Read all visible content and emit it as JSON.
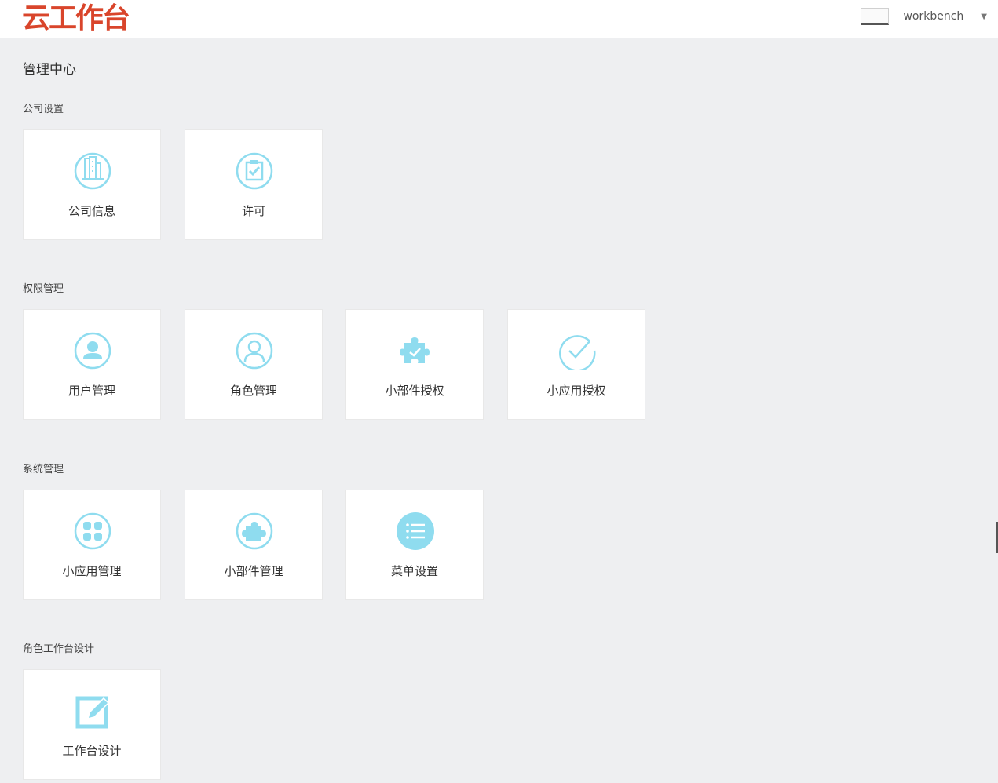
{
  "header": {
    "logo_text": "云工作台",
    "username": "workbench",
    "caret": "▼",
    "brand_color": "#d9452b"
  },
  "page": {
    "title": "管理中心"
  },
  "sections": [
    {
      "title": "公司设置",
      "cards": [
        {
          "label": "公司信息",
          "icon": "building-icon"
        },
        {
          "label": "许可",
          "icon": "clipboard-check-icon"
        }
      ]
    },
    {
      "title": "权限管理",
      "cards": [
        {
          "label": "用户管理",
          "icon": "user-filled-icon"
        },
        {
          "label": "角色管理",
          "icon": "user-outline-icon"
        },
        {
          "label": "小部件授权",
          "icon": "puzzle-check-icon"
        },
        {
          "label": "小应用授权",
          "icon": "check-circle-icon"
        }
      ]
    },
    {
      "title": "系统管理",
      "cards": [
        {
          "label": "小应用管理",
          "icon": "grid-icon"
        },
        {
          "label": "小部件管理",
          "icon": "puzzle-icon"
        },
        {
          "label": "菜单设置",
          "icon": "list-icon"
        }
      ]
    },
    {
      "title": "角色工作台设计",
      "cards": [
        {
          "label": "工作台设计",
          "icon": "edit-icon"
        }
      ]
    }
  ],
  "icon_color": "#8fdcef"
}
